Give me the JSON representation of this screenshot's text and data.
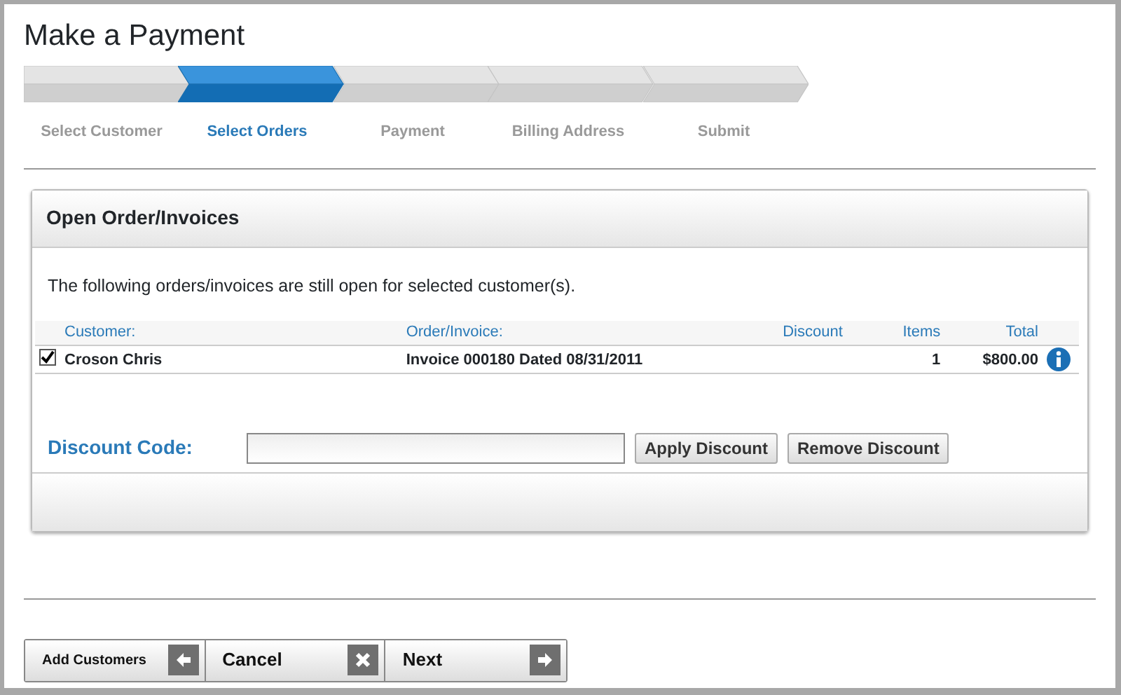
{
  "title": "Make a Payment",
  "steps": [
    {
      "label": "Select Customer",
      "selected": false
    },
    {
      "label": "Select Orders",
      "selected": true
    },
    {
      "label": "Payment",
      "selected": false
    },
    {
      "label": "Billing Address",
      "selected": false
    },
    {
      "label": "Submit",
      "selected": false
    }
  ],
  "panel": {
    "title": "Open Order/Invoices",
    "message": "The following orders/invoices are still open for selected customer(s).",
    "columns": [
      "Customer:",
      "Order/Invoice:",
      "Discount",
      "Items",
      "Total"
    ],
    "rows": [
      {
        "checked": true,
        "customer": "Croson Chris",
        "order": "Invoice 000180 Dated 08/31/2011",
        "discount": "",
        "items": "1",
        "total": "$800.00"
      }
    ],
    "discount_label": "Discount Code:",
    "buttons": [
      "Apply Discount",
      "Remove Discount"
    ]
  },
  "footer_buttons": [
    {
      "label": "Add Customers",
      "kind": "back"
    },
    {
      "label": "Cancel",
      "kind": "cancel"
    },
    {
      "label": "Next",
      "kind": "next"
    }
  ]
}
